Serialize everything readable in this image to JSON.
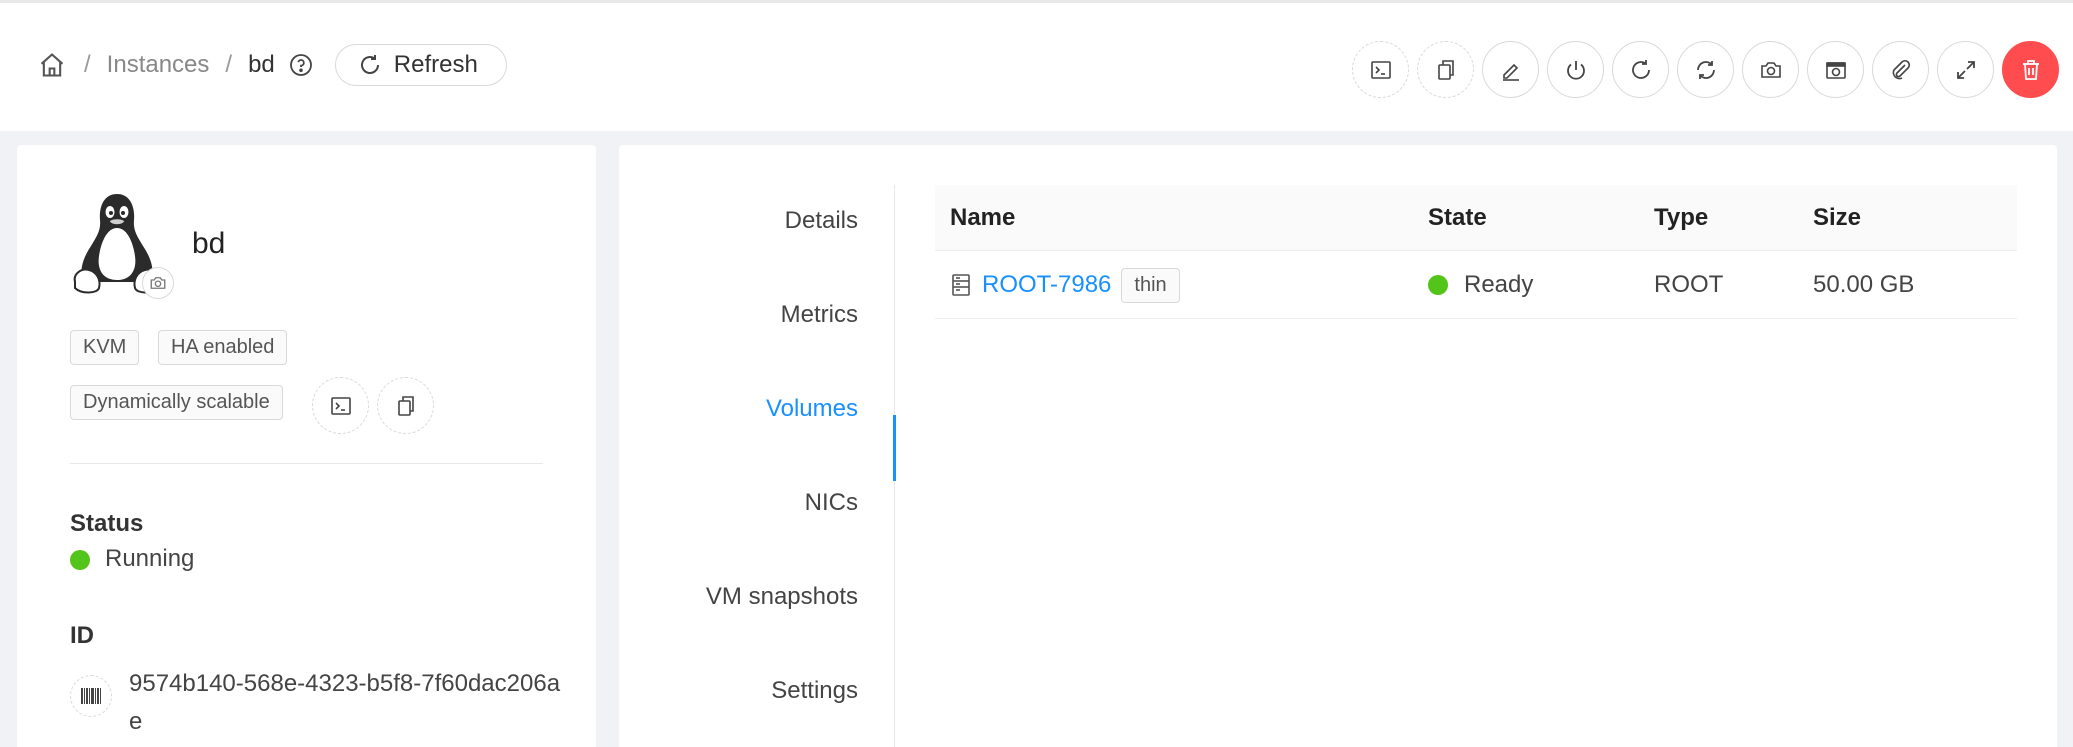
{
  "breadcrumb": {
    "home_icon": "home-icon",
    "instances": "Instances",
    "separator": "/",
    "current": "bd",
    "help_icon": "question-circle-icon"
  },
  "refresh_label": "Refresh",
  "toolbar_icons": [
    "console-icon",
    "copy-icon",
    "edit-icon",
    "power-icon",
    "reboot-icon",
    "reinstall-icon",
    "snapshot-camera-icon",
    "vm-snapshot-icon",
    "attach-iso-icon",
    "scale-icon",
    "delete-icon"
  ],
  "vm": {
    "name": "bd",
    "os_icon": "linux-tux-icon",
    "tags": [
      "KVM",
      "HA enabled",
      "Dynamically scalable"
    ],
    "status_label": "Status",
    "status": "Running",
    "id_label": "ID",
    "id": "9574b140-568e-4323-b5f8-7f60dac206ae"
  },
  "tabs": [
    "Details",
    "Metrics",
    "Volumes",
    "NICs",
    "VM snapshots",
    "Settings"
  ],
  "active_tab": "Volumes",
  "volumes": {
    "columns": [
      "Name",
      "State",
      "Type",
      "Size"
    ],
    "rows": [
      {
        "name": "ROOT-7986",
        "provisioning": "thin",
        "state": "Ready",
        "type": "ROOT",
        "size": "50.00 GB"
      }
    ]
  },
  "colors": {
    "accent": "#1890ff",
    "success": "#52c41a",
    "danger": "#ff4d4f"
  }
}
